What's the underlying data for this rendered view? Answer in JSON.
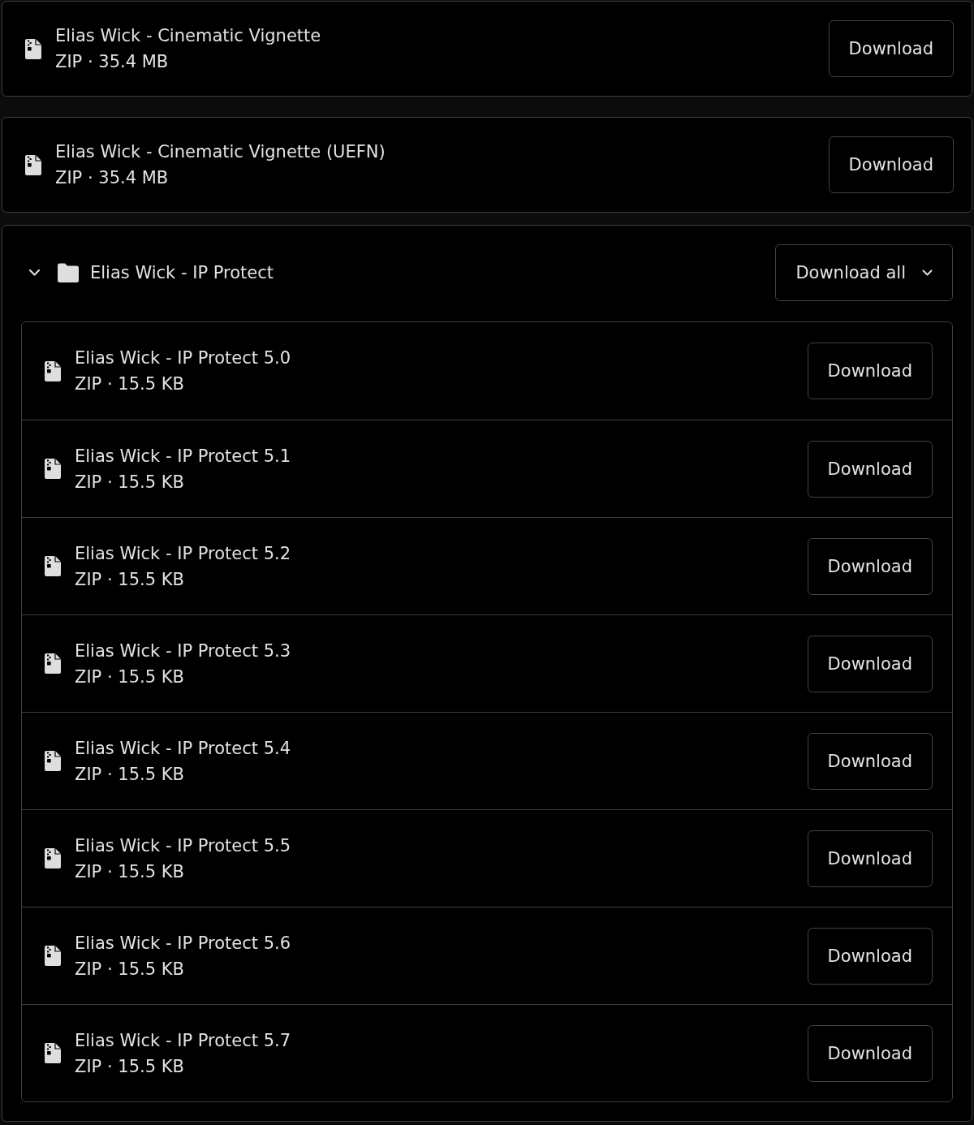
{
  "items": [
    {
      "kind": "file",
      "name": "Elias Wick - Cinematic Vignette",
      "meta": "ZIP · 35.4 MB",
      "button": "Download"
    },
    {
      "kind": "file",
      "name": "Elias Wick - Cinematic Vignette (UEFN)",
      "meta": "ZIP · 35.4 MB",
      "button": "Download"
    },
    {
      "kind": "folder",
      "name": "Elias Wick - IP Protect",
      "expanded": true,
      "button": "Download all",
      "children": [
        {
          "kind": "file",
          "name": "Elias Wick - IP Protect 5.0",
          "meta": "ZIP · 15.5 KB",
          "button": "Download"
        },
        {
          "kind": "file",
          "name": "Elias Wick - IP Protect 5.1",
          "meta": "ZIP · 15.5 KB",
          "button": "Download"
        },
        {
          "kind": "file",
          "name": "Elias Wick - IP Protect 5.2",
          "meta": "ZIP · 15.5 KB",
          "button": "Download"
        },
        {
          "kind": "file",
          "name": "Elias Wick - IP Protect 5.3",
          "meta": "ZIP · 15.5 KB",
          "button": "Download"
        },
        {
          "kind": "file",
          "name": "Elias Wick - IP Protect 5.4",
          "meta": "ZIP · 15.5 KB",
          "button": "Download"
        },
        {
          "kind": "file",
          "name": "Elias Wick - IP Protect 5.5",
          "meta": "ZIP · 15.5 KB",
          "button": "Download"
        },
        {
          "kind": "file",
          "name": "Elias Wick - IP Protect 5.6",
          "meta": "ZIP · 15.5 KB",
          "button": "Download"
        },
        {
          "kind": "file",
          "name": "Elias Wick - IP Protect 5.7",
          "meta": "ZIP · 15.5 KB",
          "button": "Download"
        }
      ]
    }
  ]
}
